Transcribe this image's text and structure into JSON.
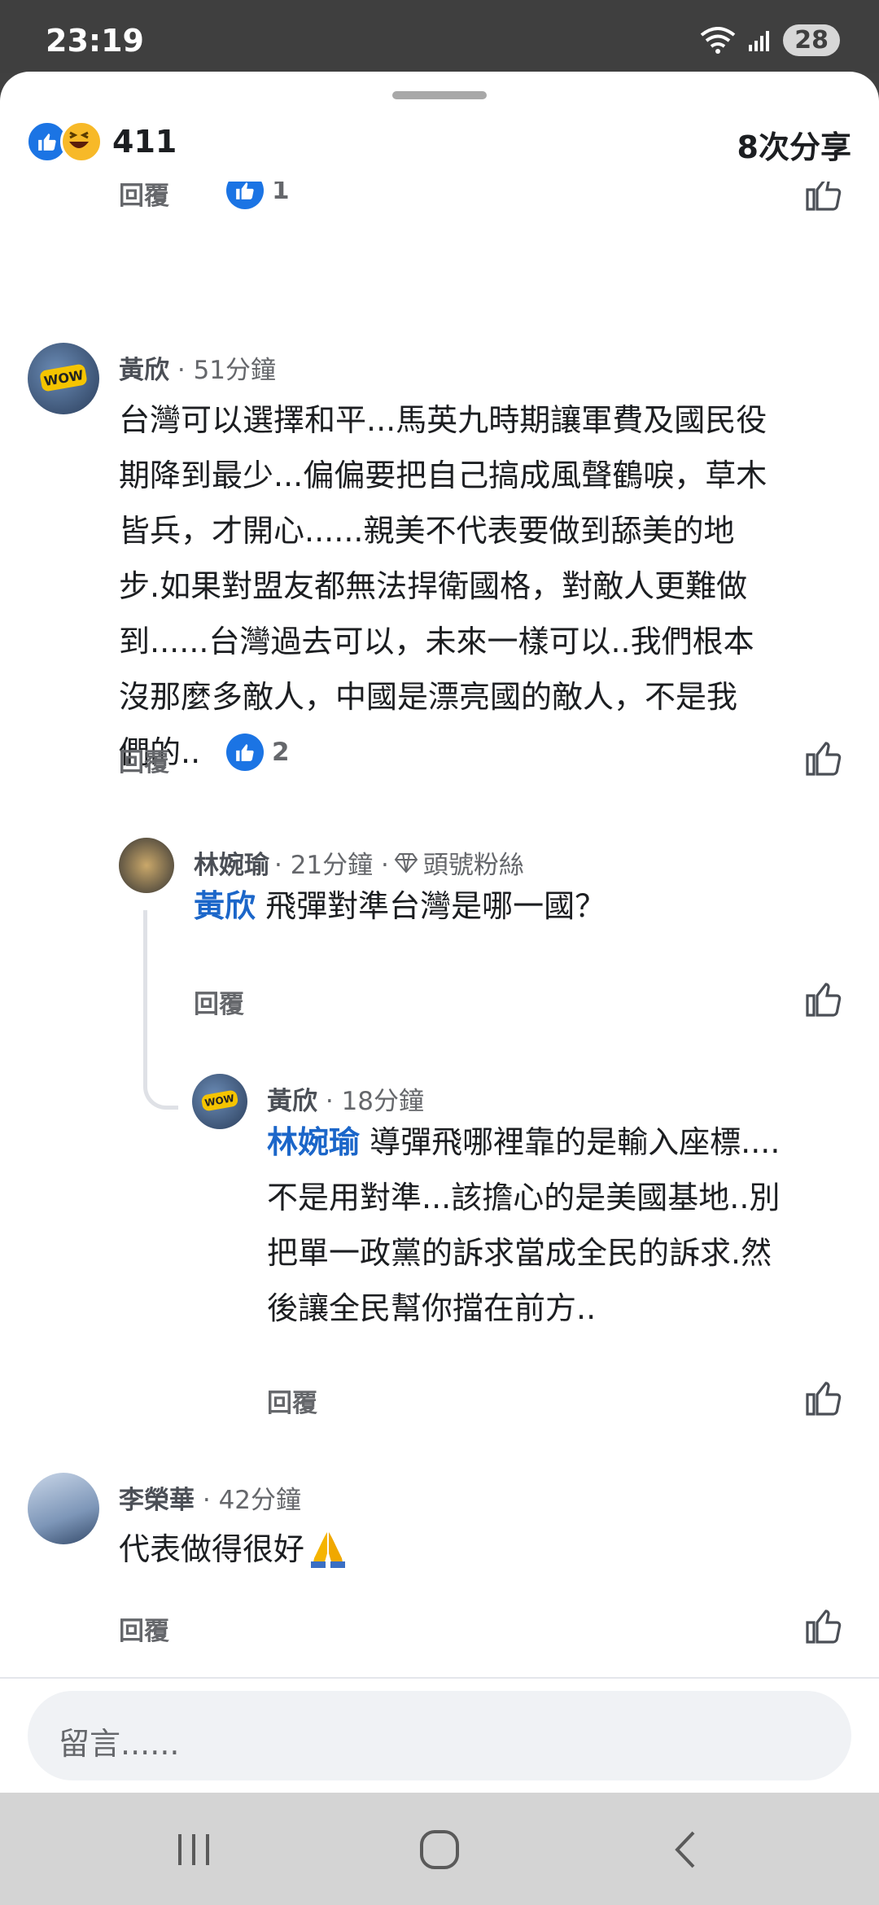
{
  "status_bar": {
    "time": "23:19",
    "battery": "28"
  },
  "header": {
    "reaction_count": "411",
    "shares": "8次分享"
  },
  "comments": [
    {
      "author": "黃欣",
      "time": "· 51分鐘",
      "text_lines": [
        "台灣可以選擇和平...馬英九時期讓軍費及國民役",
        "期降到最少...偏偏要把自己搞成風聲鶴唳，草木",
        "皆兵，才開心......親美不代表要做到舔美的地",
        "步.如果對盟友都無法捍衛國格，對敵人更難做",
        "到......台灣過去可以，未來一樣可以..我們根本",
        "沒那麼多敵人，中國是漂亮國的敵人，不是我",
        "們的.."
      ],
      "reply": "回覆",
      "likes": "2"
    },
    {
      "author": "林婉瑜",
      "time": "· 21分鐘 ·",
      "badge": "頭號粉絲",
      "mention": "黃欣",
      "text": "飛彈對準台灣是哪一國？",
      "reply": "回覆"
    },
    {
      "author": "黃欣",
      "time": "· 18分鐘",
      "mention": "林婉瑜",
      "text_lines": [
        "導彈飛哪裡靠的是輸入座標....",
        "不是用對準...該擔心的是美國基地..別",
        "把單一政黨的訴求當成全民的訴求.然",
        "後讓全民幫你擋在前方.."
      ],
      "reply": "回覆"
    },
    {
      "author": "李榮華",
      "time": "· 42分鐘",
      "text": "代表做得很好",
      "reply": "回覆"
    }
  ],
  "partial_above": {
    "reply": "回覆",
    "likes": "1"
  },
  "composer": {
    "placeholder": "留言......"
  },
  "nav": {
    "recents": "recents-icon",
    "home": "home-icon",
    "back": "back-icon"
  }
}
